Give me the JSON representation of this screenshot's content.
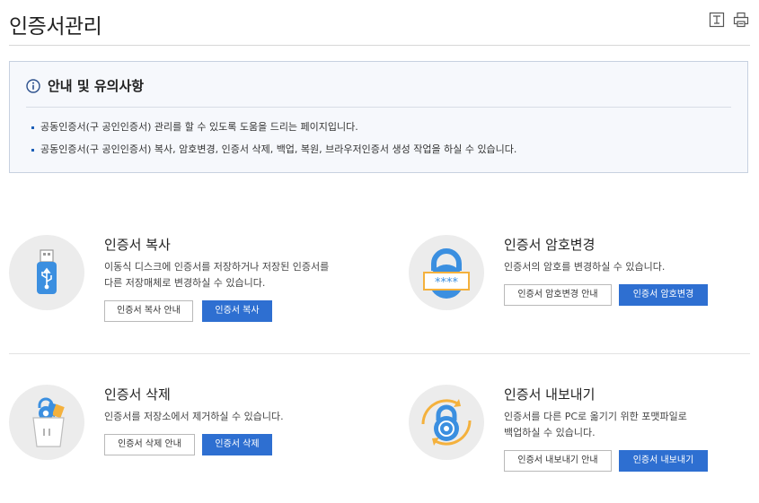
{
  "header": {
    "title": "인증서관리",
    "tools": [
      {
        "icon": "download-icon"
      },
      {
        "icon": "print-icon"
      }
    ]
  },
  "notice": {
    "icon": "info-circle-icon",
    "title": "안내 및 유의사항",
    "items": [
      "공동인증서(구 공인인증서) 관리를 할 수 있도록 도움을 드리는 페이지입니다.",
      "공동인증서(구 공인인증서) 복사, 암호변경, 인증서 삭제, 백업, 복원, 브라우저인증서 생성 작업을 하실 수 있습니다."
    ]
  },
  "cards": {
    "copy": {
      "icon": "usb-icon",
      "title": "인증서 복사",
      "desc": [
        "이동식 디스크에 인증서를 저장하거나 저장된 인증서를",
        "다른 저장매체로 변경하실 수 있습니다."
      ],
      "guide_label": "인증서 복사 안내",
      "action_label": "인증서 복사"
    },
    "password": {
      "icon": "padlock-password-icon",
      "title": "인증서 암호변경",
      "desc": [
        "인증서의 암호를 변경하실 수 있습니다."
      ],
      "guide_label": "인증서 암호변경 안내",
      "action_label": "인증서 암호변경"
    },
    "delete": {
      "icon": "trash-padlock-icon",
      "title": "인증서 삭제",
      "desc": [
        "인증서를 저장소에서 제거하실 수 있습니다."
      ],
      "guide_label": "인증서 삭제 안내",
      "action_label": "인증서 삭제"
    },
    "export": {
      "icon": "padlock-arrows-icon",
      "title": "인증서 내보내기",
      "desc": [
        "인증서를 다른 PC로 옮기기 위한 포맷파일로",
        "백업하실 수 있습니다."
      ],
      "guide_label": "인증서 내보내기 안내",
      "action_label": "인증서 내보내기"
    }
  },
  "colors": {
    "primary": "#2e6fd1",
    "notice_bg": "#f6f8fc",
    "icon_blue": "#3b8fe0",
    "icon_gold": "#f4b13d"
  }
}
